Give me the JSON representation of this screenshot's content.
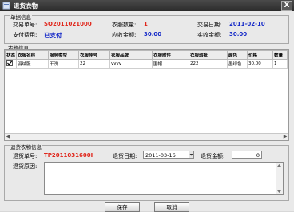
{
  "window": {
    "title": "退货衣物",
    "close_label": "X"
  },
  "order_info": {
    "legend": "单据信息",
    "order_no_label": "交易单号:",
    "order_no": "SQ2011021000",
    "clothes_count_label": "衣服数量:",
    "clothes_count": "1",
    "trade_date_label": "交易日期:",
    "trade_date": "2011-02-10",
    "payment_label": "支付费用:",
    "payment": "已支付",
    "due_amount_label": "应收金额:",
    "due_amount": "30.00",
    "paid_amount_label": "实收金额:",
    "paid_amount": "30.00"
  },
  "clothes_info": {
    "legend": "衣物信息",
    "columns": [
      "状态",
      "衣服名称",
      "服务类型",
      "衣服挂号",
      "衣服品牌",
      "衣服附件",
      "衣服瑕疵",
      "颜色",
      "价格",
      "数量"
    ],
    "rows": [
      [
        "",
        "羽绒服",
        "干洗",
        "22",
        "vvvv",
        "围帽",
        "222",
        "墨绿色",
        "30.00",
        "1"
      ]
    ]
  },
  "return_info": {
    "legend": "退货衣物信息",
    "return_no_label": "退货单号:",
    "return_no": "TP2011031600I",
    "return_date_label": "退货日期:",
    "return_date": "2011-03-16",
    "return_amount_label": "退货金额:",
    "return_amount": "0",
    "reason_label": "退货原因:",
    "reason": ""
  },
  "buttons": {
    "save": "保存",
    "cancel": "取消"
  },
  "colors": {
    "red_value": "#e0261b",
    "blue_value": "#1529c8",
    "title_bar": "#2b2b2b"
  }
}
